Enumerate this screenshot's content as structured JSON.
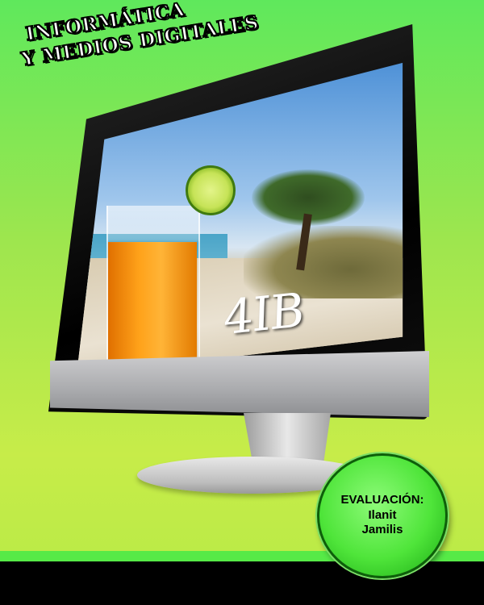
{
  "title": {
    "line1": "INFORMÁTICA",
    "line2": "Y MEDIOS DIGITALES"
  },
  "screen": {
    "label": "4IB"
  },
  "badge": {
    "heading": "EVALUACIÓN:",
    "name1": "Ilanit",
    "name2": "Jamilis",
    "color": "#4fe53a"
  },
  "colors": {
    "background_top": "#5fe85c",
    "background_bottom": "#b6ea46",
    "footer": "#000000"
  }
}
